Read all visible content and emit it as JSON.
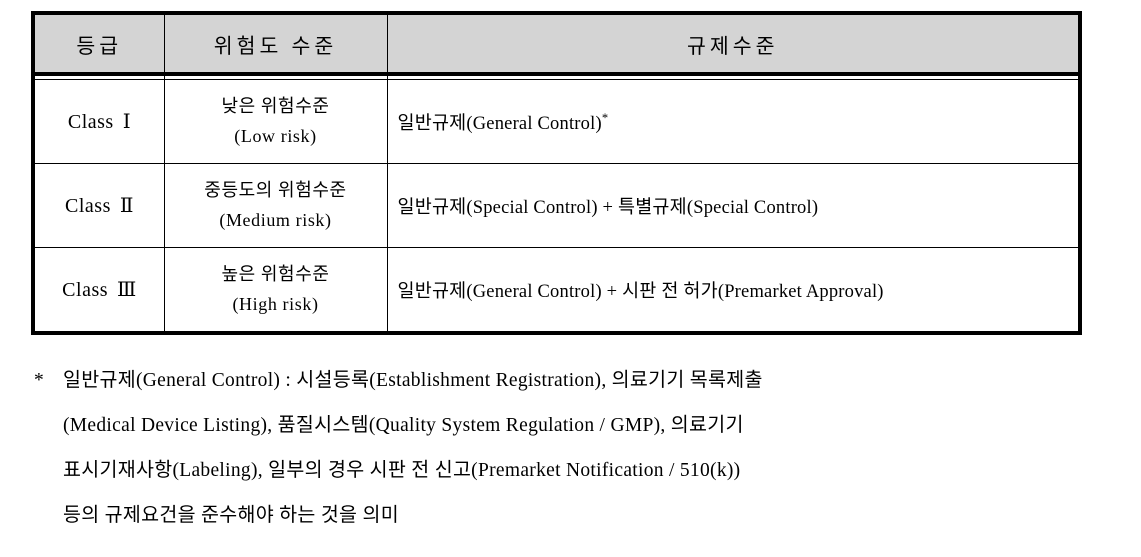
{
  "table": {
    "headers": [
      {
        "label": "등급"
      },
      {
        "label": "위험도 수준"
      },
      {
        "label": "규제수준"
      }
    ],
    "rows": [
      {
        "grade_word": "Class",
        "grade_num": "Ⅰ",
        "risk_kr": "낮은 위험수준",
        "risk_en": "(Low risk)",
        "regulation": "일반규제(General Control)",
        "regulation_sup": "*"
      },
      {
        "grade_word": "Class",
        "grade_num": "Ⅱ",
        "risk_kr": "중등도의 위험수준",
        "risk_en": "(Medium risk)",
        "regulation": "일반규제(Special Control) + 특별규제(Special Control)",
        "regulation_sup": ""
      },
      {
        "grade_word": "Class",
        "grade_num": "Ⅲ",
        "risk_kr": "높은 위험수준",
        "risk_en": "(High risk)",
        "regulation": "일반규제(General Control) + 시판 전 허가(Premarket Approval)",
        "regulation_sup": ""
      }
    ]
  },
  "footnote": {
    "marker": "*",
    "lines": [
      "일반규제(General Control) : 시설등록(Establishment Registration), 의료기기 목록제출",
      "(Medical Device Listing), 품질시스템(Quality System Regulation / GMP), 의료기기",
      "표시기재사항(Labeling), 일부의 경우 시판 전 신고(Premarket Notification / 510(k))",
      "등의 규제요건을 준수해야 하는 것을 의미"
    ]
  }
}
